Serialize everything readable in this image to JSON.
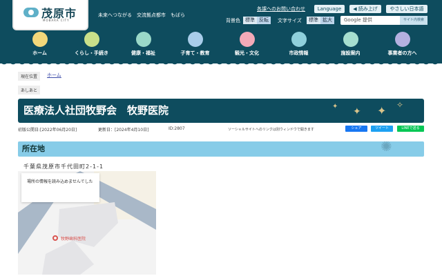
{
  "header": {
    "logo_name": "茂原市",
    "logo_sub": "MOBARA CITY",
    "tagline": "未来へつながる　交流拠点都市　もばら",
    "contact_link": "各課へのお問い合わせ",
    "language": "Language",
    "read_aloud": "読み上げ",
    "easy_japanese": "やさしい日本語",
    "bg_label": "背景色",
    "bg_options": [
      "標準",
      "反転"
    ],
    "font_label": "文字サイズ",
    "font_options": [
      "標準",
      "拡大"
    ],
    "search_placeholder": "Google 提供",
    "search_button": "サイト内検索"
  },
  "nav": [
    {
      "label": "ホーム",
      "color": "#f3d77a"
    },
    {
      "label": "くらし・手続き",
      "color": "#c9e08a"
    },
    {
      "label": "健康・福祉",
      "color": "#9ad8c8"
    },
    {
      "label": "子育て・教育",
      "color": "#a9cdea"
    },
    {
      "label": "観光・文化",
      "color": "#f2a9b8"
    },
    {
      "label": "市政情報",
      "color": "#8fd0dc"
    },
    {
      "label": "施設案内",
      "color": "#a6dfd0"
    },
    {
      "label": "事業者の方へ",
      "color": "#b4b0e0"
    }
  ],
  "breadcrumb": {
    "label": "現在位置",
    "home": "ホーム",
    "footprint": "あしあと"
  },
  "page": {
    "title": "医療法人社団牧野会　牧野医院",
    "published": "初版公開日:[2022年06月20日]",
    "updated": "更新日：[2024年4月10日]",
    "id": "ID:2807",
    "sns_note": "ソーシャルサイトへのリンクは別ウィンドウで開きます",
    "share_fb": "シェア",
    "share_tw": "ツイート",
    "share_line": "LINEで送る"
  },
  "location": {
    "heading": "所在地",
    "address": "千葉県茂原市千代田町2-1-1",
    "map_error": "場所の情報を読み込めませんでした",
    "map_pin": "牧野歯科医院"
  }
}
